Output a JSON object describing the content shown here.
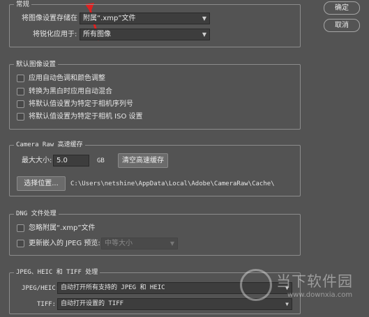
{
  "general": {
    "legend": "常规",
    "save_settings_label": "将图像设置存储在",
    "save_settings_value": "附属“.xmp”文件",
    "sharpen_label": "将锐化应用于:",
    "sharpen_value": "所有图像"
  },
  "default_settings": {
    "legend": "默认图像设置",
    "options": [
      "应用自动色调和颜色调整",
      "转换为黑白时应用自动混合",
      "将默认值设置为特定于相机序列号",
      "将默认值设置为特定于相机 ISO 设置"
    ]
  },
  "cache": {
    "legend": "Camera Raw 高速缓存",
    "max_size_label": "最大大小:",
    "max_size_value": "5.0",
    "unit": "GB",
    "purge_button": "清空高速缓存",
    "select_location_button": "选择位置...",
    "path": "C:\\Users\\netshine\\AppData\\Local\\Adobe\\CameraRaw\\Cache\\"
  },
  "dng": {
    "legend": "DNG 文件处理",
    "ignore_sidecar": "忽略附属“.xmp”文件",
    "update_preview": "更新嵌入的 JPEG 预览:",
    "preview_size": "中等大小"
  },
  "jpeg_heic_tiff": {
    "legend": "JPEG、HEIC 和 TIFF 处理",
    "jpeg_label": "JPEG/HEIC:",
    "jpeg_value": "自动打开所有支持的 JPEG 和 HEIC",
    "tiff_label": "TIFF:",
    "tiff_value": "自动打开设置的 TIFF"
  },
  "buttons": {
    "ok": "确定",
    "cancel": "取消"
  },
  "watermark": {
    "text": "当下软件园",
    "url": "www.downxia.com"
  },
  "icons": {
    "annotation": "red-arrow-icon",
    "dropdown": "chevron-down-icon",
    "watermark": "downxia-logo-icon"
  },
  "colors": {
    "background": "#535353",
    "annotation_arrow": "#e02020"
  }
}
